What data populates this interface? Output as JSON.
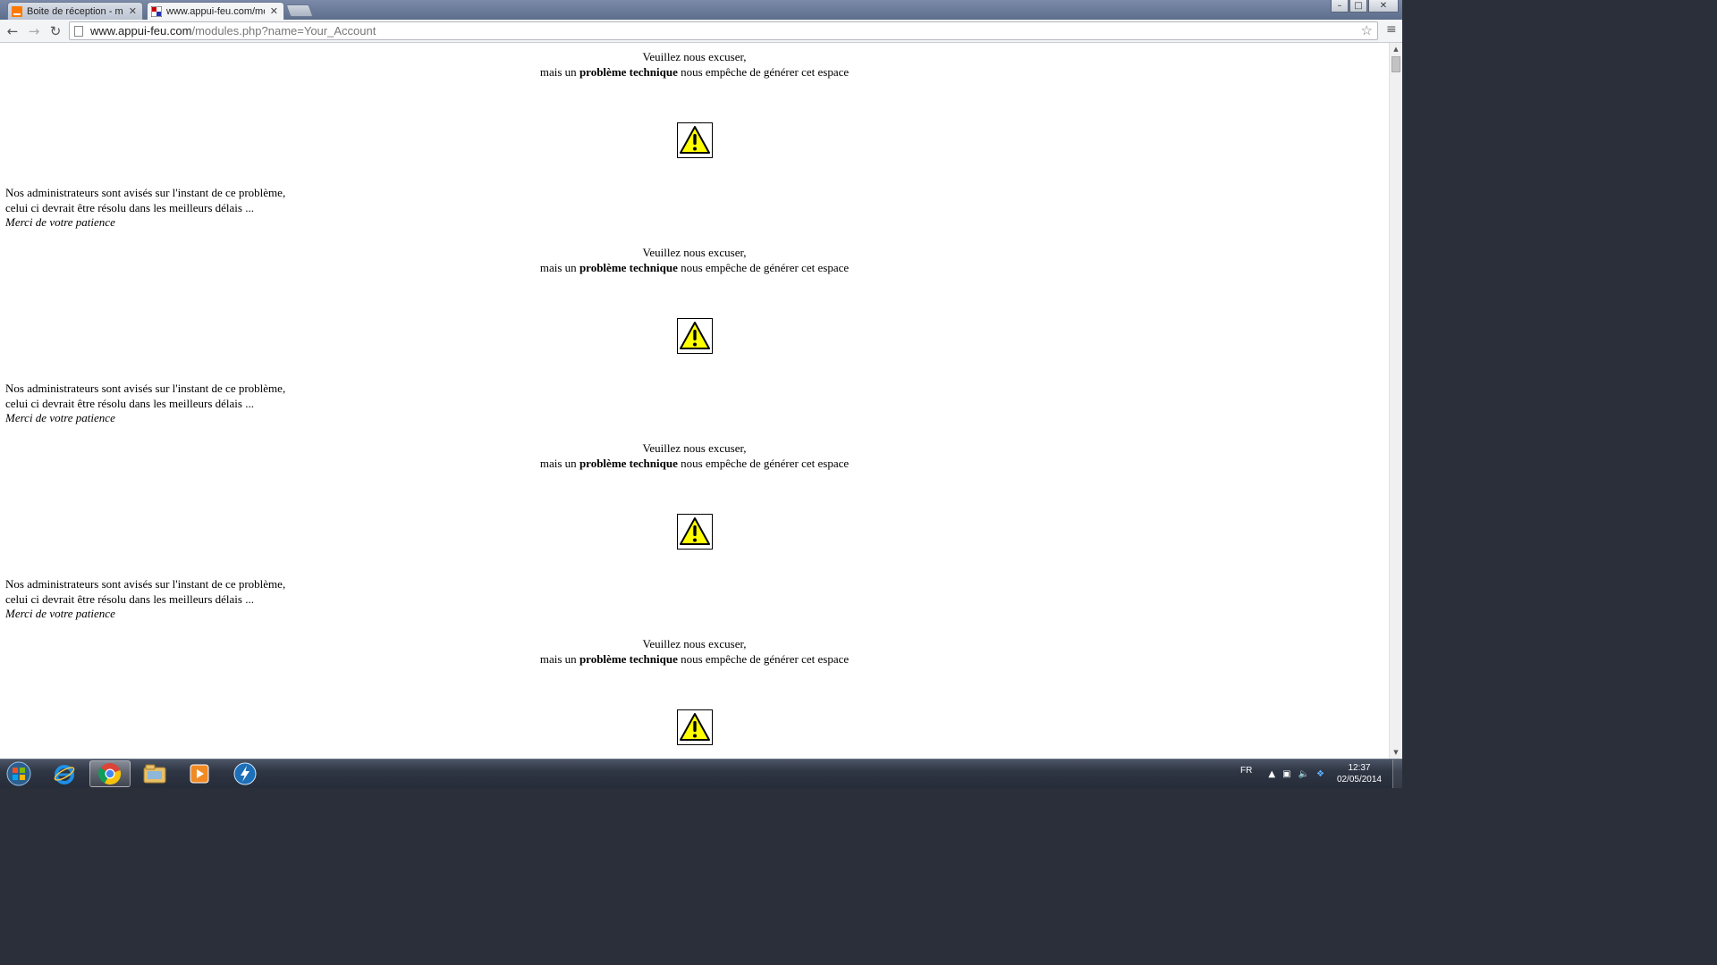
{
  "browser": {
    "tabs": [
      {
        "title": "Boite de réception - mail",
        "active": false,
        "favicon": "orange-mail-icon"
      },
      {
        "title": "www.appui-feu.com/mod",
        "active": true,
        "favicon": "appui-feu-icon"
      }
    ],
    "tab_close_glyph": "✕",
    "window_controls": {
      "minimize": "–",
      "maximize": "□",
      "close": "✕"
    },
    "nav": {
      "back": "←",
      "forward": "→",
      "reload": "↻"
    },
    "url": {
      "host": "www.appui-feu.com",
      "path": "/modules.php?name=Your_Account"
    },
    "star_glyph": "☆",
    "menu_glyph": "≡"
  },
  "page": {
    "error_blocks": [
      {
        "line1": "Veuillez nous excuser,",
        "line2_prefix": "mais un ",
        "line2_bold": "problème technique",
        "line2_suffix": " nous empêche de générer cet espace",
        "admin_line1": "Nos administrateurs sont avisés sur l'instant de ce problème,",
        "admin_line2": "celui ci devrait être résolu dans les meilleurs délais ...",
        "patience": "Merci de votre patience"
      },
      {
        "line1": "Veuillez nous excuser,",
        "line2_prefix": "mais un ",
        "line2_bold": "problème technique",
        "line2_suffix": " nous empêche de générer cet espace",
        "admin_line1": "Nos administrateurs sont avisés sur l'instant de ce problème,",
        "admin_line2": "celui ci devrait être résolu dans les meilleurs délais ...",
        "patience": "Merci de votre patience"
      },
      {
        "line1": "Veuillez nous excuser,",
        "line2_prefix": "mais un ",
        "line2_bold": "problème technique",
        "line2_suffix": " nous empêche de générer cet espace",
        "admin_line1": "Nos administrateurs sont avisés sur l'instant de ce problème,",
        "admin_line2": "celui ci devrait être résolu dans les meilleurs délais ...",
        "patience": "Merci de votre patience"
      },
      {
        "line1": "Veuillez nous excuser,",
        "line2_prefix": "mais un ",
        "line2_bold": "problème technique",
        "line2_suffix": " nous empêche de générer cet espace",
        "admin_line1": "",
        "admin_line2": "",
        "patience": ""
      }
    ],
    "warning_icon": "warning-triangle-icon",
    "warning_color": "#ffff00"
  },
  "scrollbar": {
    "up": "▲",
    "down": "▼"
  },
  "taskbar": {
    "pinned": [
      {
        "name": "start-orb",
        "active": false
      },
      {
        "name": "internet-explorer-icon",
        "active": false
      },
      {
        "name": "chrome-icon",
        "active": true
      },
      {
        "name": "file-explorer-icon",
        "active": false
      },
      {
        "name": "media-player-icon",
        "active": false
      },
      {
        "name": "lightning-app-icon",
        "active": false
      }
    ],
    "tray": {
      "language": "FR",
      "show_hidden_glyph": "▲",
      "network_glyph": "▣",
      "volume_glyph": "🔈",
      "dropbox_glyph": "❖",
      "time": "12:37",
      "date": "02/05/2014"
    }
  }
}
